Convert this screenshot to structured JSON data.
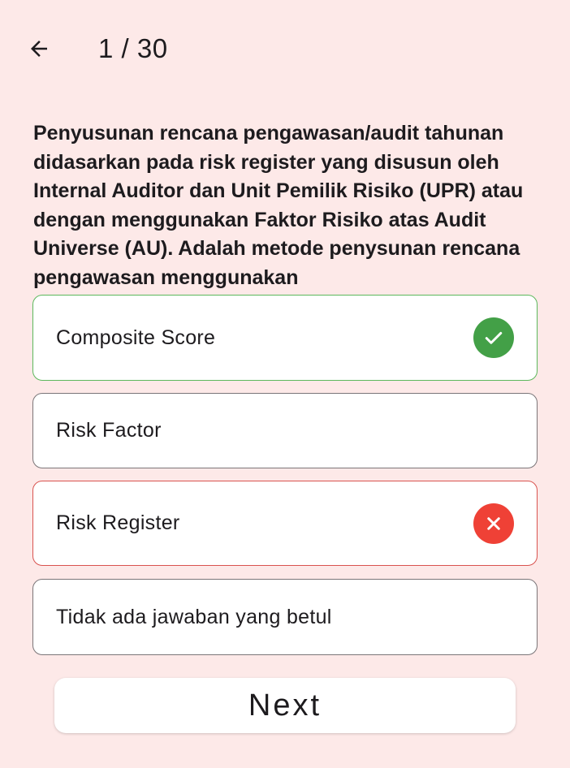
{
  "header": {
    "back_icon": "arrow-left-icon",
    "progress": "1 / 30"
  },
  "question": {
    "text": "Penyusunan rencana pengawasan/audit tahunan didasarkan pada risk register yang disusun oleh Internal Auditor dan Unit Pemilik Risiko (UPR) atau dengan menggunakan Faktor Risiko atas Audit Universe (AU). Adalah metode penysunan rencana pengawasan menggunakan"
  },
  "options": [
    {
      "label": "Composite Score",
      "status": "correct",
      "icon": "check-circle-icon"
    },
    {
      "label": "Risk Factor",
      "status": "neutral"
    },
    {
      "label": "Risk Register",
      "status": "wrong",
      "icon": "cross-circle-icon"
    },
    {
      "label": "Tidak ada jawaban yang betul",
      "status": "neutral"
    }
  ],
  "next_button": {
    "label": "Next"
  },
  "colors": {
    "background": "#fde9e8",
    "correct": "#43a047",
    "wrong": "#ef4136",
    "correct_border": "#5cb85c",
    "wrong_border": "#d9534f"
  }
}
